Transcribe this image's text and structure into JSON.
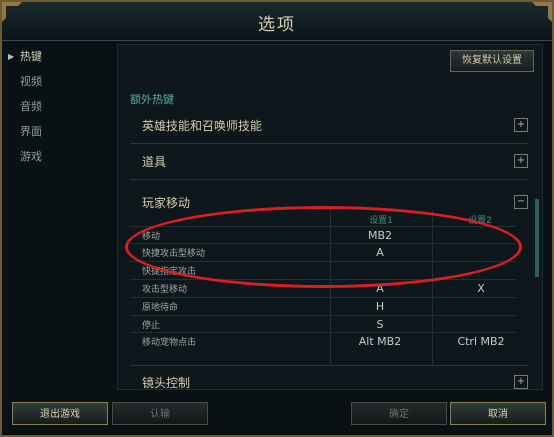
{
  "window": {
    "title": "选项"
  },
  "sidebar": {
    "items": [
      {
        "label": "热键",
        "active": true
      },
      {
        "label": "视频",
        "active": false
      },
      {
        "label": "音频",
        "active": false
      },
      {
        "label": "界面",
        "active": false
      },
      {
        "label": "游戏",
        "active": false
      }
    ]
  },
  "content": {
    "restore_label": "恢复默认设置",
    "group_title": "额外热键",
    "sections": [
      {
        "label": "英雄技能和召唤师技能",
        "toggle": "+"
      },
      {
        "label": "道具",
        "toggle": "+"
      },
      {
        "label": "玩家移动",
        "toggle": "−"
      },
      {
        "label": "镜头控制",
        "toggle": "+"
      }
    ],
    "table": {
      "headers": [
        "设置1",
        "设置2"
      ],
      "rows": [
        {
          "label": "移动",
          "set1": "MB2",
          "set2": ""
        },
        {
          "label": "快捷攻击型移动",
          "set1": "A",
          "set2": ""
        },
        {
          "label": "快捷指定攻击",
          "set1": "",
          "set2": ""
        },
        {
          "label": "攻击型移动",
          "set1": "A",
          "set2": "X"
        },
        {
          "label": "原地待命",
          "set1": "H",
          "set2": ""
        },
        {
          "label": "停止",
          "set1": "S",
          "set2": ""
        },
        {
          "label": "移动宠物点击",
          "set1": "Alt MB2",
          "set2": "Ctrl MB2"
        }
      ]
    }
  },
  "footer": {
    "exit_label": "退出游戏",
    "confirm_label": "认输",
    "ok_label": "确定",
    "cancel_label": "取消"
  },
  "colors": {
    "accent": "#4fb0a6",
    "frame": "#6d5a36",
    "highlight_ellipse": "#d81f25"
  }
}
